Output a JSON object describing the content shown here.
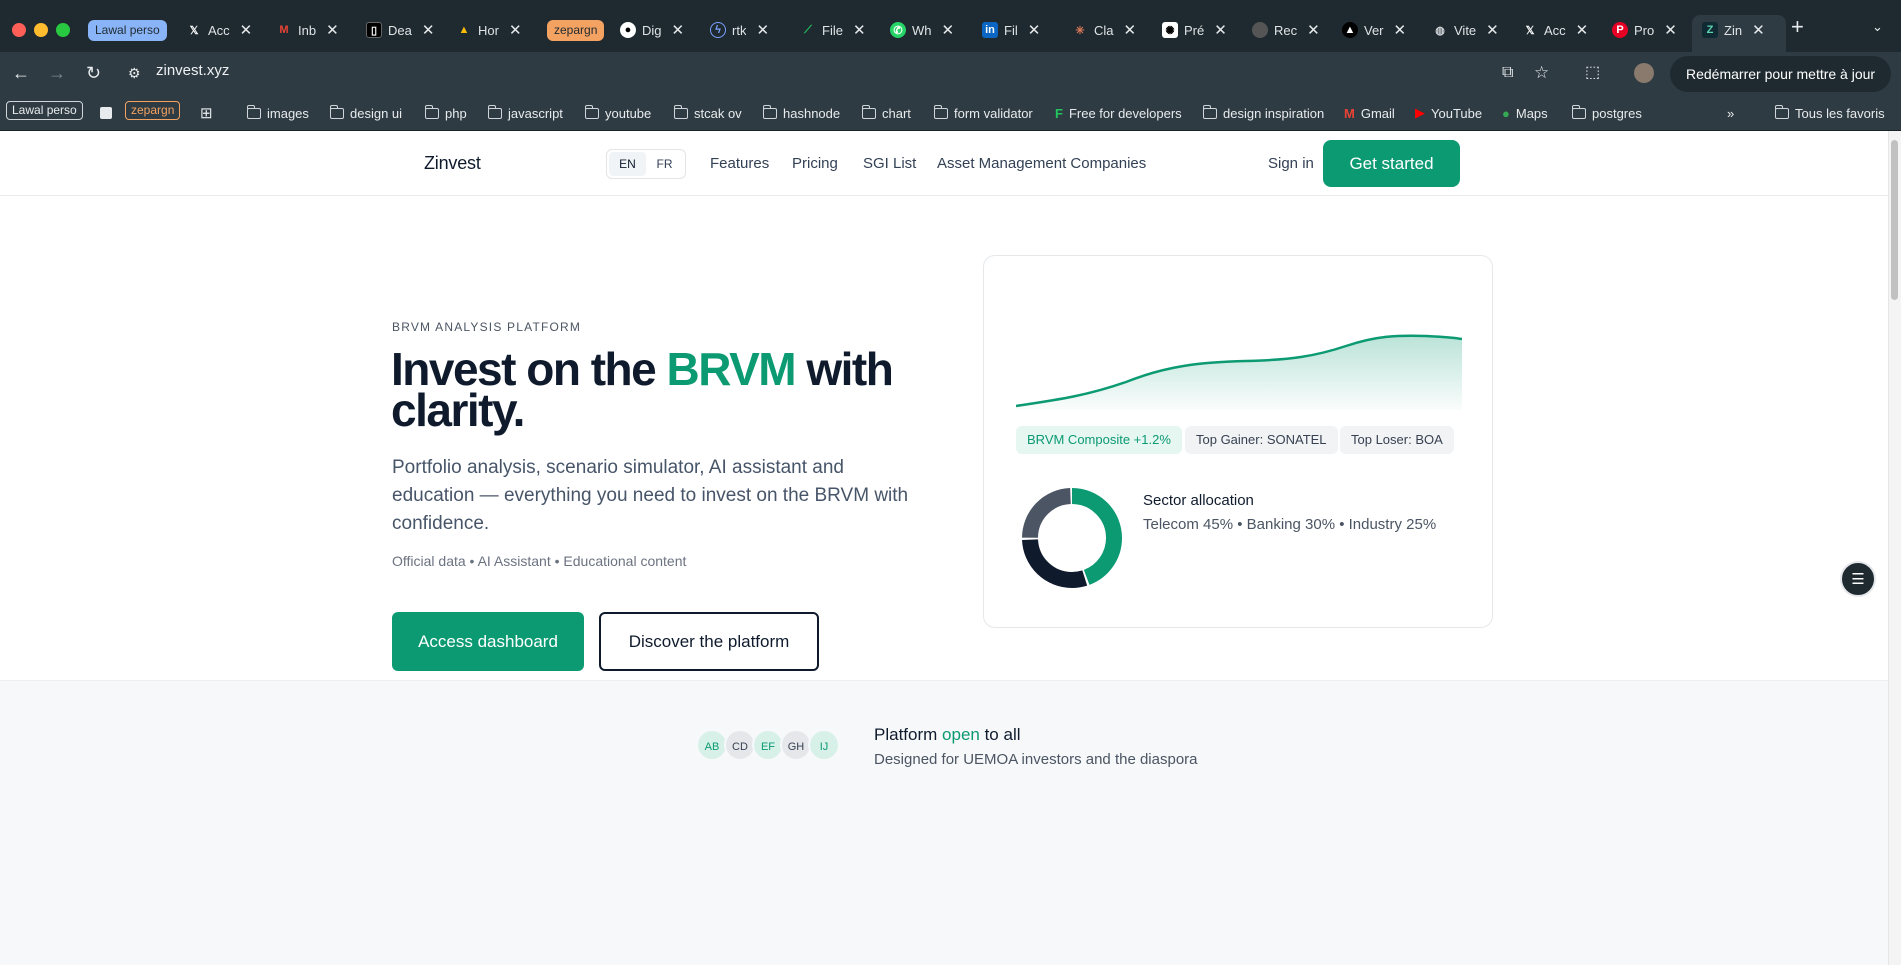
{
  "browser": {
    "tab_groups": [
      "Lawal perso",
      "zepargn"
    ],
    "tabs": [
      {
        "title": "Acc",
        "icon": "x-logo-icon"
      },
      {
        "title": "Inb",
        "icon": "gmail-icon"
      },
      {
        "title": "Dea",
        "icon": "app-icon"
      },
      {
        "title": "Hor",
        "icon": "drive-icon"
      },
      {
        "title": "Dig",
        "icon": "github-icon"
      },
      {
        "title": "rtk",
        "icon": "bolt-icon"
      },
      {
        "title": "File",
        "icon": "file-icon"
      },
      {
        "title": "Wh",
        "icon": "whatsapp-icon"
      },
      {
        "title": "Fil",
        "icon": "linkedin-icon"
      },
      {
        "title": "Cla",
        "icon": "claude-icon"
      },
      {
        "title": "Pré",
        "icon": "openai-icon"
      },
      {
        "title": "Rec",
        "icon": "globe-icon"
      },
      {
        "title": "Ver",
        "icon": "vercel-icon"
      },
      {
        "title": "Vite",
        "icon": "globe-icon"
      },
      {
        "title": "Acc",
        "icon": "x-logo-icon"
      },
      {
        "title": "Pro",
        "icon": "pinterest-icon"
      },
      {
        "title": "Zin",
        "icon": "zinvest-icon"
      }
    ],
    "url": "zinvest.xyz",
    "restart_label": "Redémarrer pour mettre à jour",
    "bookmarks": {
      "chips": [
        "Lawal perso",
        "zepargn"
      ],
      "items": [
        "images",
        "design ui",
        "php",
        "javascript",
        "youtube",
        "stcak ov",
        "hashnode",
        "chart",
        "form validator",
        "Free for developers",
        "design inspiration",
        "Gmail",
        "YouTube",
        "Maps",
        "postgres"
      ],
      "overflow": "»",
      "all": "Tous les favoris"
    }
  },
  "site": {
    "logo": "Zinvest",
    "lang": {
      "en": "EN",
      "fr": "FR"
    },
    "nav": [
      "Features",
      "Pricing",
      "SGI List",
      "Asset Management Companies"
    ],
    "sign_in": "Sign in",
    "get_started": "Get started"
  },
  "hero": {
    "eyebrow": "BRVM ANALYSIS PLATFORM",
    "headline_pre": "Invest on the ",
    "headline_accent": "BRVM",
    "headline_post": " with clarity.",
    "lead": "Portfolio analysis, scenario simulator, AI assistant and education — everything you need to invest on the BRVM with confidence.",
    "meta": "Official data • AI Assistant • Educational content",
    "primary_cta": "Access dashboard",
    "secondary_cta": "Discover the platform"
  },
  "card": {
    "pills": [
      "BRVM Composite +1.2%",
      "Top Gainer: SONATEL",
      "Top Loser: BOA"
    ],
    "sector_title": "Sector allocation",
    "sector_text": "Telecom 45% • Banking 30% • Industry 25%",
    "sectors": [
      {
        "name": "Telecom",
        "share": 45,
        "color": "#0b9a72"
      },
      {
        "name": "Banking",
        "share": 30,
        "color": "#0f1b2d"
      },
      {
        "name": "Industry",
        "share": 25,
        "color": "#4b5563"
      }
    ]
  },
  "trust": {
    "avatars": [
      "AB",
      "CD",
      "EF",
      "GH",
      "IJ"
    ],
    "title_pre": "Platform ",
    "title_accent": "open",
    "title_post": " to all",
    "subtitle": "Designed for UEMOA investors and the diaspora"
  },
  "colors": {
    "brand": "#0b9a72",
    "ink": "#0f1b2d"
  }
}
